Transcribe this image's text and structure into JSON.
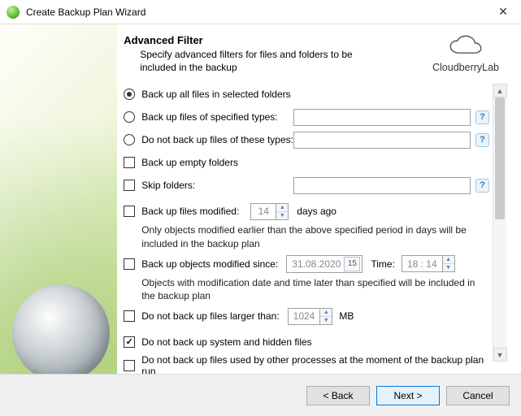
{
  "window": {
    "title": "Create Backup Plan Wizard",
    "close_glyph": "✕"
  },
  "brand": {
    "name": "CloudberryLab"
  },
  "header": {
    "title": "Advanced Filter",
    "subtitle": "Specify advanced filters for files and folders to be included in the backup"
  },
  "options": {
    "radio_all": "Back up all files in selected folders",
    "radio_include_types": "Back up files of specified types:",
    "radio_exclude_types": "Do not back up files of these types:",
    "include_types_value": "",
    "exclude_types_value": "",
    "cb_empty_folders": "Back up empty folders",
    "cb_skip_folders": "Skip folders:",
    "skip_folders_value": "",
    "cb_modified_days": "Back up files modified:",
    "modified_days_value": "14",
    "modified_days_suffix": "days ago",
    "hint_modified_days": "Only objects modified earlier than the above specified period in days will be included in the backup plan",
    "cb_modified_since": "Back up objects modified since:",
    "modified_since_date": "31.08.2020",
    "modified_since_day": "15",
    "time_label": "Time:",
    "modified_since_time": "18 : 14",
    "hint_modified_since": "Objects with modification date and time later than specified will be included in the backup plan",
    "cb_not_larger": "Do not back up files larger than:",
    "not_larger_value": "1024",
    "not_larger_unit": "MB",
    "cb_skip_system": "Do not back up system and hidden files",
    "cb_skip_locked": "Do not back up files used by other processes at the moment of the backup plan run"
  },
  "help_glyph": "?",
  "spin_up": "▲",
  "spin_down": "▼",
  "scroll": {
    "up": "▲",
    "down": "▼"
  },
  "footer": {
    "back": "< Back",
    "next": "Next >",
    "cancel": "Cancel"
  }
}
